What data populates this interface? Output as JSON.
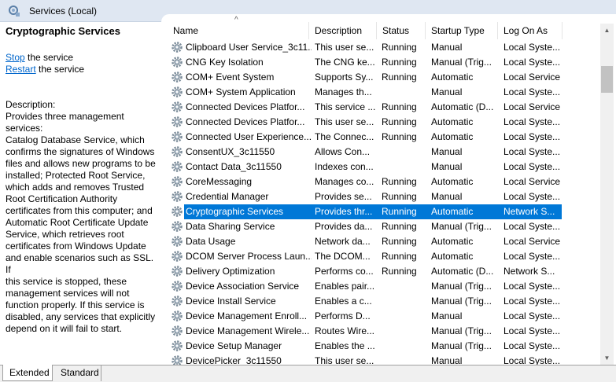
{
  "window": {
    "title": "Services (Local)"
  },
  "left": {
    "title": "Cryptographic Services",
    "stop_link": "Stop",
    "stop_rest": " the service",
    "restart_link": "Restart",
    "restart_rest": " the service",
    "desc_label": "Description:",
    "description_lines": [
      "Provides three management services:",
      "Catalog Database Service, which",
      "confirms the signatures of Windows",
      "files and allows new programs to be",
      "installed; Protected Root Service,",
      "which adds and removes Trusted",
      "Root Certification Authority",
      "certificates from this computer; and",
      "Automatic Root Certificate Update",
      "Service, which retrieves root",
      "certificates from Windows Update",
      "and enable scenarios such as SSL. If",
      "this service is stopped, these",
      "management services will not",
      "function properly. If this service is",
      "disabled, any services that explicitly",
      "depend on it will fail to start."
    ]
  },
  "table": {
    "columns": [
      "Name",
      "Description",
      "Status",
      "Startup Type",
      "Log On As"
    ],
    "sort_indicator": "^",
    "rows": [
      [
        "Clipboard User Service_3c11...",
        "This user se...",
        "Running",
        "Manual",
        "Local Syste..."
      ],
      [
        "CNG Key Isolation",
        "The CNG ke...",
        "Running",
        "Manual (Trig...",
        "Local Syste..."
      ],
      [
        "COM+ Event System",
        "Supports Sy...",
        "Running",
        "Automatic",
        "Local Service"
      ],
      [
        "COM+ System Application",
        "Manages th...",
        "",
        "Manual",
        "Local Syste..."
      ],
      [
        "Connected Devices Platfor...",
        "This service ...",
        "Running",
        "Automatic (D...",
        "Local Service"
      ],
      [
        "Connected Devices Platfor...",
        "This user se...",
        "Running",
        "Automatic",
        "Local Syste..."
      ],
      [
        "Connected User Experience...",
        "The Connec...",
        "Running",
        "Automatic",
        "Local Syste..."
      ],
      [
        "ConsentUX_3c11550",
        "Allows Con...",
        "",
        "Manual",
        "Local Syste..."
      ],
      [
        "Contact Data_3c11550",
        "Indexes con...",
        "",
        "Manual",
        "Local Syste..."
      ],
      [
        "CoreMessaging",
        "Manages co...",
        "Running",
        "Automatic",
        "Local Service"
      ],
      [
        "Credential Manager",
        "Provides se...",
        "Running",
        "Manual",
        "Local Syste..."
      ],
      [
        "Cryptographic Services",
        "Provides thr...",
        "Running",
        "Automatic",
        "Network S..."
      ],
      [
        "Data Sharing Service",
        "Provides da...",
        "Running",
        "Manual (Trig...",
        "Local Syste..."
      ],
      [
        "Data Usage",
        "Network da...",
        "Running",
        "Automatic",
        "Local Service"
      ],
      [
        "DCOM Server Process Laun...",
        "The DCOM...",
        "Running",
        "Automatic",
        "Local Syste..."
      ],
      [
        "Delivery Optimization",
        "Performs co...",
        "Running",
        "Automatic (D...",
        "Network S..."
      ],
      [
        "Device Association Service",
        "Enables pair...",
        "",
        "Manual (Trig...",
        "Local Syste..."
      ],
      [
        "Device Install Service",
        "Enables a c...",
        "",
        "Manual (Trig...",
        "Local Syste..."
      ],
      [
        "Device Management Enroll...",
        "Performs D...",
        "",
        "Manual",
        "Local Syste..."
      ],
      [
        "Device Management Wirele...",
        "Routes Wire...",
        "",
        "Manual (Trig...",
        "Local Syste..."
      ],
      [
        "Device Setup Manager",
        "Enables the ...",
        "",
        "Manual (Trig...",
        "Local Syste..."
      ],
      [
        "DevicePicker_3c11550",
        "This user se...",
        "",
        "Manual",
        "Local Syste..."
      ]
    ],
    "selected_index": 11
  },
  "tabs": [
    "Extended",
    "Standard"
  ],
  "colors": {
    "selection": "#0078d7",
    "link": "#0066cc"
  }
}
